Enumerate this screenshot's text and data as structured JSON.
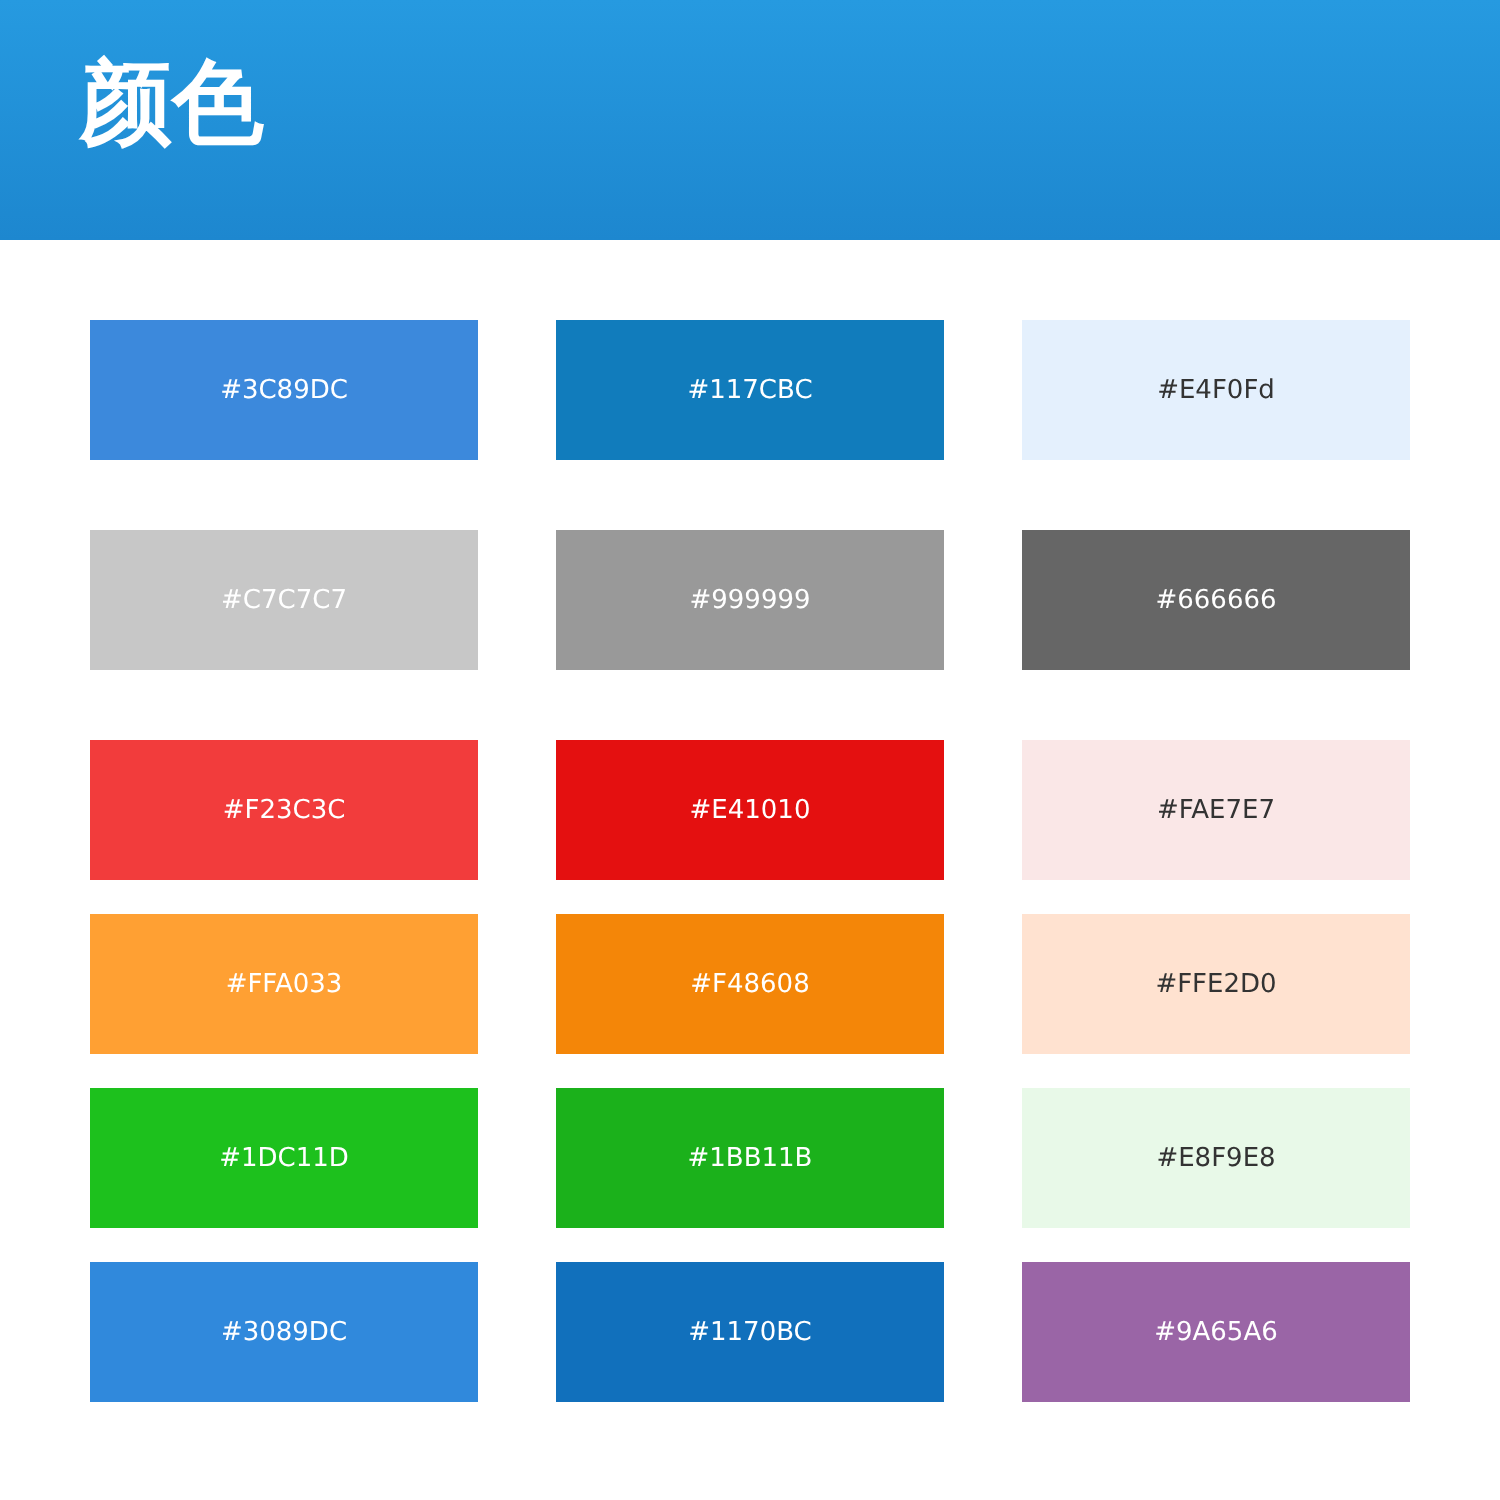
{
  "header": {
    "title": "颜色"
  },
  "sections": [
    {
      "swatches": [
        {
          "label": "#3C89DC",
          "color": "#3c89dc"
        },
        {
          "label": "#117CBC",
          "color": "#117cbc"
        },
        {
          "label": "#E4F0Fd",
          "color": "#e4f0fd"
        }
      ]
    },
    {
      "swatches": [
        {
          "label": "#C7C7C7",
          "color": "#c7c7c7"
        },
        {
          "label": "#999999",
          "color": "#999999"
        },
        {
          "label": "#666666",
          "color": "#666666"
        }
      ]
    },
    {
      "swatches": [
        {
          "label": "#F23C3C",
          "color": "#f23c3c"
        },
        {
          "label": "#E41010",
          "color": "#e41010"
        },
        {
          "label": "#FAE7E7",
          "color": "#fae7e7"
        },
        {
          "label": "#FFA033",
          "color": "#ffa033"
        },
        {
          "label": "#F48608",
          "color": "#f48608"
        },
        {
          "label": "#FFE2D0",
          "color": "#ffe2d0"
        },
        {
          "label": "#1DC11D",
          "color": "#1dc11d"
        },
        {
          "label": "#1BB11B",
          "color": "#1bb11b"
        },
        {
          "label": "#E8F9E8",
          "color": "#e8f9e8"
        },
        {
          "label": "#3089DC",
          "color": "#3089dc"
        },
        {
          "label": "#1170BC",
          "color": "#1170bc"
        },
        {
          "label": "#9A65A6",
          "color": "#9a65a6"
        }
      ]
    }
  ]
}
